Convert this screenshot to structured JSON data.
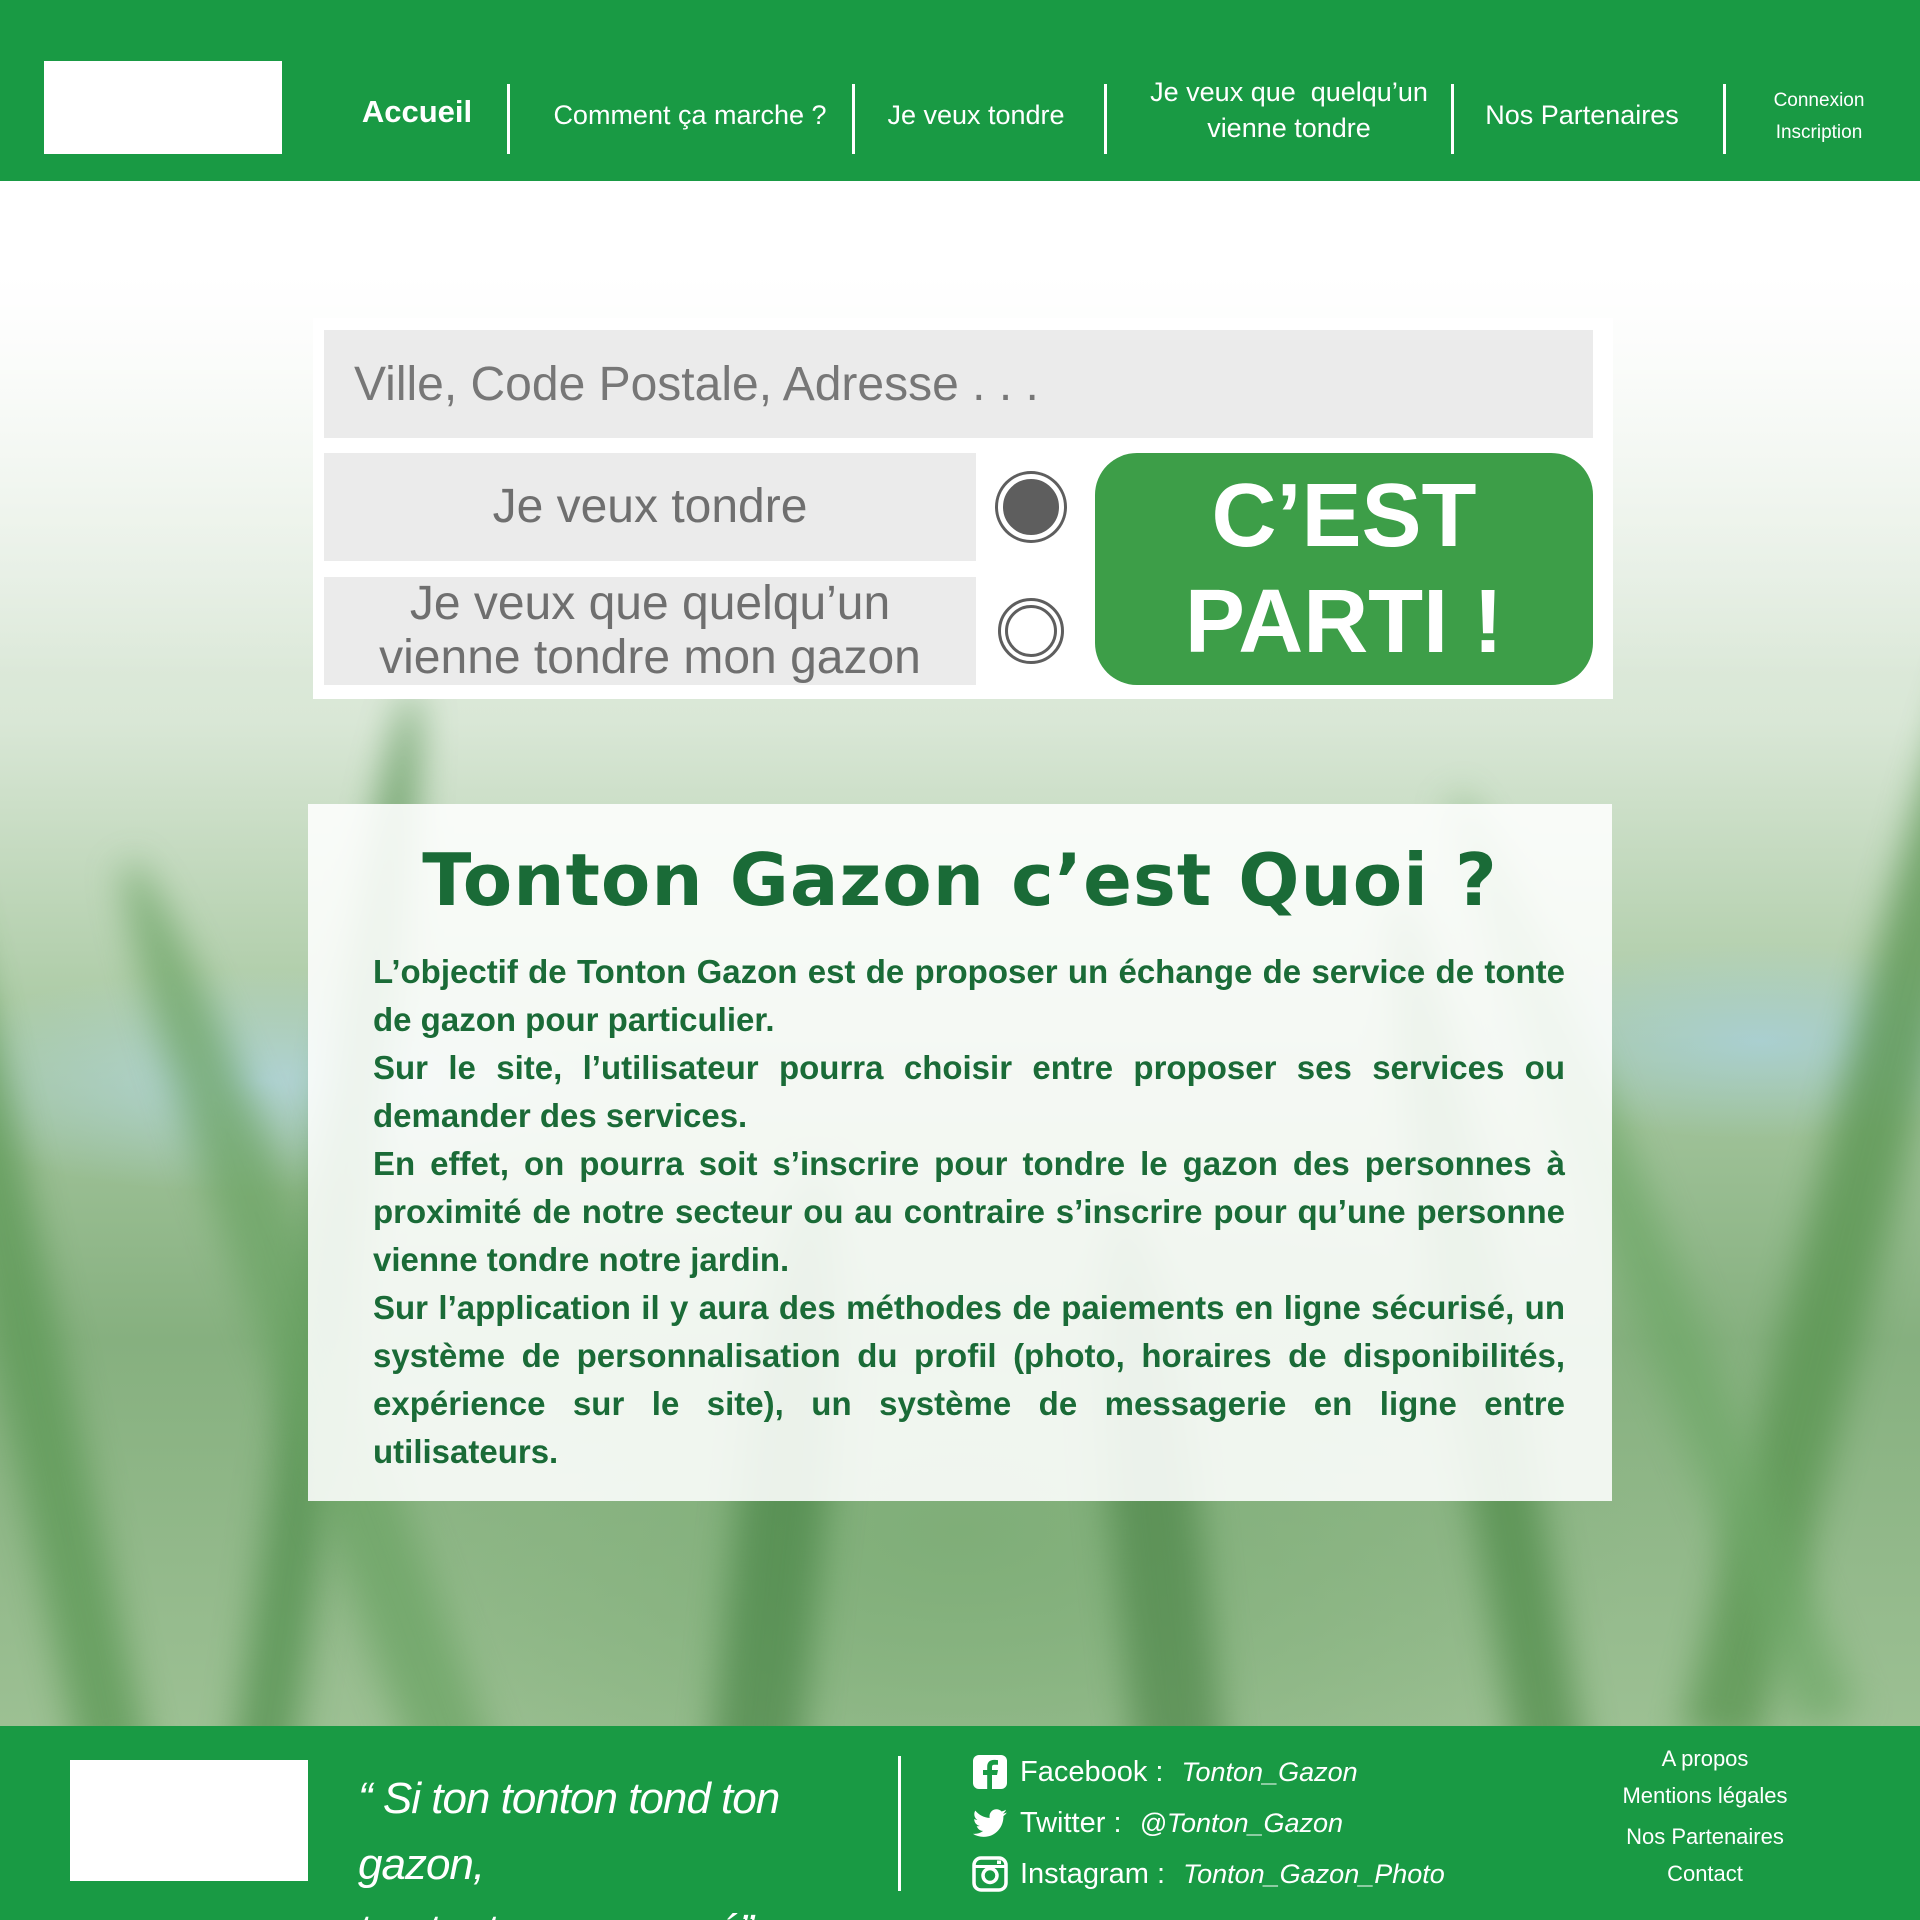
{
  "colors": {
    "brand_green": "#199a44",
    "button_green": "#3d9e48",
    "title_green": "#1a6b37",
    "input_gray": "#ebebeb"
  },
  "header": {
    "nav": {
      "accueil": "Accueil",
      "comment": "Comment ça marche ?",
      "tondre": "Je veux tondre",
      "quelquun_line1": "Je veux que  quelqu’un",
      "quelquun_line2": "vienne tondre",
      "partenaires": "Nos Partenaires",
      "connexion": "Connexion",
      "inscription": "Inscription"
    }
  },
  "search": {
    "placeholder": "Ville, Code Postale, Adresse . . .",
    "option1": "Je veux tondre",
    "option2_line1": "Je veux que quelqu’un",
    "option2_line2": "vienne tondre mon gazon",
    "selected_option": "option1",
    "go_line1": "C’EST",
    "go_line2": "PARTI !"
  },
  "about": {
    "title": "Tonton Gazon c’est Quoi ?",
    "paragraphs": [
      "L’objectif de Tonton Gazon est de proposer un échange de service de tonte de gazon pour particulier.",
      "Sur le site, l’utilisateur pourra choisir entre proposer ses services ou demander des services.",
      "En effet, on pourra soit s’inscrire pour tondre le gazon des personnes à proximité de notre secteur ou au contraire s’inscrire pour qu’une personne vienne tondre notre jardin.",
      "Sur l’application il y aura des méthodes de paiements en ligne sécurisé, un système de personnalisation du profil (photo, horaires de disponibilités, expérience sur le site), un système de messagerie en ligne entre utilisateurs."
    ]
  },
  "footer": {
    "slogan_line1": "“ Si ton tonton tond ton gazon,",
    "slogan_line2": "ton tonton sera payé”",
    "social": [
      {
        "icon": "facebook-icon",
        "label": "Facebook :",
        "handle": "Tonton_Gazon"
      },
      {
        "icon": "twitter-icon",
        "label": "Twitter :",
        "handle": "@Tonton_Gazon"
      },
      {
        "icon": "instagram-icon",
        "label": "Instagram :",
        "handle": "Tonton_Gazon_Photo"
      }
    ],
    "links": [
      "A propos",
      "Mentions légales",
      "Nos Partenaires",
      "Contact"
    ]
  }
}
